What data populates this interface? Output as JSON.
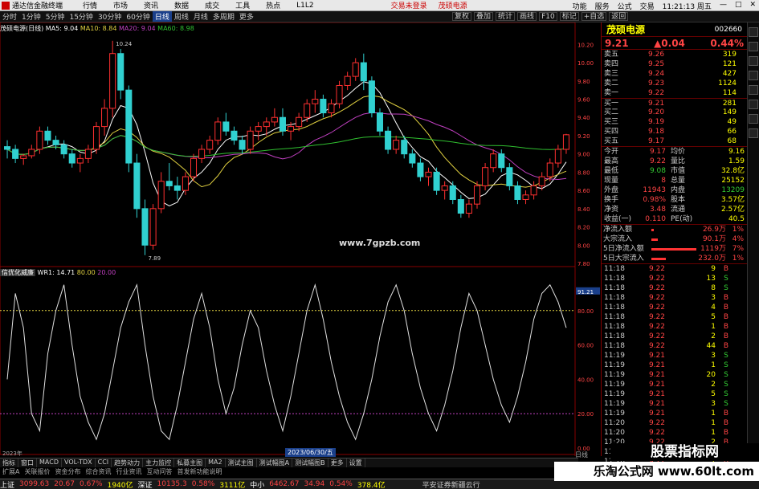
{
  "app": {
    "name": "通达信金融终端",
    "menus": [
      "行情",
      "市场",
      "资讯",
      "数据",
      "成交",
      "工具",
      "热点",
      "L1L2"
    ],
    "center": [
      "交易未登录",
      "茂硕电源"
    ],
    "right": [
      "功能",
      "服务",
      "公式",
      "交易"
    ],
    "time": "11:21:13 周五"
  },
  "toolbar": {
    "periods": [
      "分时",
      "1分钟",
      "5分钟",
      "15分钟",
      "30分钟",
      "60分钟",
      "日线",
      "周线",
      "月线",
      "多周期",
      "更多"
    ],
    "active_period": "日线",
    "tools": [
      "复权",
      "叠加",
      "统计",
      "画线",
      "F10",
      "标记",
      "+自选",
      "返回"
    ]
  },
  "chart_head": {
    "title": "茂硕电源(日线)",
    "ma5": "MA5: 9.04",
    "ma10": "MA10: 8.84",
    "ma20": "MA20: 9.04",
    "ma60": "MA60: 8.98"
  },
  "price_axis": [
    "10.20",
    "10.00",
    "9.80",
    "9.60",
    "9.40",
    "9.20",
    "9.00",
    "8.80",
    "8.60",
    "8.40",
    "8.20",
    "8.00",
    "7.80"
  ],
  "annotations": {
    "high": "10.24",
    "low": "7.89"
  },
  "watermark_center": "www.7gpzb.com",
  "indicator": {
    "name": "信优化威廉",
    "wr": "WR1: 14.71",
    "l1": "80.00",
    "l2": "20.00",
    "axis": [
      "91.21",
      "80.00",
      "60.00",
      "40.00",
      "20.00",
      "0.00"
    ]
  },
  "date_axis": {
    "start": "2023年",
    "highlight": "2023/06/30/五",
    "right": "日线"
  },
  "bottom_tabs": [
    "指标",
    "窗口",
    "MACD",
    "VOL-TDX",
    "CCI",
    "趋势动力",
    "主力监控",
    "私募主图",
    "MA2",
    "测试主图",
    "测试幅图A",
    "测试幅图B",
    "更多",
    "设置"
  ],
  "bottom_tabs2": [
    "扩展A",
    "关联报价",
    "资金分布",
    "综合资讯",
    "行业资讯",
    "互动问答",
    "首发新功能说明"
  ],
  "stock": {
    "name": "茂硕电源",
    "code": "002660",
    "price": "9.21",
    "change": "▲0.04",
    "pct": "0.44%"
  },
  "orderbook": [
    {
      "label": "卖五",
      "price": "9.26",
      "vol": "319"
    },
    {
      "label": "卖四",
      "price": "9.25",
      "vol": "121"
    },
    {
      "label": "卖三",
      "price": "9.24",
      "vol": "427"
    },
    {
      "label": "卖二",
      "price": "9.23",
      "vol": "1124"
    },
    {
      "label": "卖一",
      "price": "9.22",
      "vol": "114"
    },
    {
      "label": "买一",
      "price": "9.21",
      "vol": "281"
    },
    {
      "label": "买二",
      "price": "9.20",
      "vol": "149"
    },
    {
      "label": "买三",
      "price": "9.19",
      "vol": "49"
    },
    {
      "label": "买四",
      "price": "9.18",
      "vol": "66"
    },
    {
      "label": "买五",
      "price": "9.17",
      "vol": "68"
    }
  ],
  "stats": [
    [
      "今开",
      "9.17",
      "均价",
      "9.16"
    ],
    [
      "最高",
      "9.22",
      "量比",
      "1.59"
    ],
    [
      "最低",
      "9.08",
      "市值",
      "32.8亿"
    ],
    [
      "现量",
      "8",
      "总量",
      "25152"
    ],
    [
      "外盘",
      "11943",
      "内盘",
      "13209"
    ],
    [
      "换手",
      "0.98%",
      "股本",
      "3.57亿"
    ],
    [
      "净资",
      "3.48",
      "流通",
      "2.57亿"
    ],
    [
      "收益(一)",
      "0.110",
      "PE(动)",
      "40.5"
    ]
  ],
  "flows": [
    {
      "label": "净流入额",
      "val": "26.9万",
      "pct": "1%",
      "bar": 0.04
    },
    {
      "label": "大宗流入",
      "val": "90.1万",
      "pct": "4%",
      "bar": 0.12
    },
    {
      "label": "5日净流入额",
      "val": "1119万",
      "pct": "7%",
      "bar": 0.8
    },
    {
      "label": "5日大宗流入",
      "val": "232.0万",
      "pct": "1%",
      "bar": 0.25
    }
  ],
  "ticks": [
    [
      "11:18",
      "9.22",
      "9",
      "B"
    ],
    [
      "11:18",
      "9.22",
      "13",
      "S"
    ],
    [
      "11:18",
      "9.22",
      "8",
      "S"
    ],
    [
      "11:18",
      "9.22",
      "3",
      "B"
    ],
    [
      "11:18",
      "9.22",
      "4",
      "B"
    ],
    [
      "11:18",
      "9.22",
      "5",
      "B"
    ],
    [
      "11:18",
      "9.22",
      "1",
      "B"
    ],
    [
      "11:18",
      "9.22",
      "2",
      "B"
    ],
    [
      "11:18",
      "9.22",
      "44",
      "B"
    ],
    [
      "11:19",
      "9.21",
      "3",
      "S"
    ],
    [
      "11:19",
      "9.21",
      "1",
      "S"
    ],
    [
      "11:19",
      "9.21",
      "20",
      "S"
    ],
    [
      "11:19",
      "9.21",
      "2",
      "S"
    ],
    [
      "11:19",
      "9.21",
      "5",
      "S"
    ],
    [
      "11:19",
      "9.21",
      "3",
      "S"
    ],
    [
      "11:19",
      "9.21",
      "1",
      "B"
    ],
    [
      "11:20",
      "9.22",
      "1",
      "B"
    ],
    [
      "11:20",
      "9.22",
      "1",
      "B"
    ],
    [
      "11:20",
      "9.22",
      "2",
      "B"
    ],
    [
      "11:20",
      "9.22",
      "4",
      "B"
    ],
    [
      "11:20",
      "9.22",
      "1",
      "B"
    ]
  ],
  "status": {
    "items": [
      "上证",
      "3099.63",
      "20.67",
      "0.67%",
      "1940亿",
      "深证",
      "10135.3",
      "0.58%",
      "3111亿",
      "中小",
      "6462.67",
      "34.94",
      "0.54%",
      "378.4亿"
    ],
    "right": "平安证券新疆云行"
  },
  "wm_bottom1": "股票指标网",
  "wm_bottom2": "乐淘公式网 www.60lt.com",
  "colors": {
    "up": "#ff3030",
    "down": "#30d0d0",
    "ma5": "#ffffff",
    "ma10": "#e0d040",
    "ma20": "#c040c0",
    "ma60": "#30c030",
    "wr": "#e0e0e0"
  },
  "chart_data": {
    "type": "candlestick",
    "ylim": [
      7.8,
      10.3
    ],
    "candles": [
      [
        9.08,
        9.15,
        8.95,
        9.05
      ],
      [
        9.05,
        9.1,
        8.9,
        8.95
      ],
      [
        8.95,
        9.0,
        8.88,
        8.98
      ],
      [
        8.98,
        9.1,
        8.95,
        9.05
      ],
      [
        9.05,
        9.3,
        9.0,
        9.25
      ],
      [
        9.25,
        9.3,
        9.1,
        9.15
      ],
      [
        9.15,
        9.2,
        9.05,
        9.1
      ],
      [
        9.1,
        9.15,
        8.95,
        9.0
      ],
      [
        9.0,
        9.05,
        8.85,
        8.9
      ],
      [
        8.9,
        9.0,
        8.8,
        8.95
      ],
      [
        8.95,
        9.1,
        8.9,
        9.05
      ],
      [
        9.05,
        9.35,
        9.0,
        9.3
      ],
      [
        9.3,
        9.6,
        9.2,
        9.5
      ],
      [
        9.5,
        10.24,
        9.4,
        10.1
      ],
      [
        10.1,
        10.15,
        9.6,
        9.7
      ],
      [
        9.7,
        9.75,
        8.8,
        8.9
      ],
      [
        8.9,
        9.0,
        8.3,
        8.4
      ],
      [
        8.4,
        8.5,
        7.89,
        8.0
      ],
      [
        8.0,
        8.45,
        7.95,
        8.4
      ],
      [
        8.4,
        8.8,
        8.35,
        8.7
      ],
      [
        8.7,
        8.9,
        8.6,
        8.65
      ],
      [
        8.65,
        8.75,
        8.5,
        8.6
      ],
      [
        8.6,
        8.8,
        8.55,
        8.75
      ],
      [
        8.75,
        9.0,
        8.7,
        8.95
      ],
      [
        8.95,
        9.1,
        8.9,
        9.05
      ],
      [
        9.05,
        9.2,
        9.0,
        9.15
      ],
      [
        9.15,
        9.4,
        9.1,
        9.35
      ],
      [
        9.35,
        9.45,
        9.2,
        9.25
      ],
      [
        9.25,
        9.3,
        9.1,
        9.15
      ],
      [
        9.15,
        9.2,
        9.0,
        9.05
      ],
      [
        9.05,
        9.3,
        9.0,
        9.25
      ],
      [
        9.25,
        9.35,
        9.15,
        9.3
      ],
      [
        9.3,
        9.4,
        9.2,
        9.35
      ],
      [
        9.35,
        9.5,
        9.3,
        9.4
      ],
      [
        9.4,
        9.5,
        9.2,
        9.25
      ],
      [
        9.25,
        9.35,
        9.15,
        9.3
      ],
      [
        9.3,
        9.45,
        9.25,
        9.4
      ],
      [
        9.4,
        9.6,
        9.35,
        9.55
      ],
      [
        9.55,
        9.7,
        9.45,
        9.6
      ],
      [
        9.6,
        9.65,
        9.4,
        9.45
      ],
      [
        9.45,
        9.6,
        9.4,
        9.55
      ],
      [
        9.55,
        9.8,
        9.5,
        9.75
      ],
      [
        9.75,
        9.9,
        9.7,
        9.85
      ],
      [
        9.85,
        10.05,
        9.8,
        10.0
      ],
      [
        10.0,
        10.1,
        9.7,
        9.8
      ],
      [
        9.8,
        9.85,
        9.4,
        9.45
      ],
      [
        9.45,
        9.5,
        9.2,
        9.25
      ],
      [
        9.25,
        9.3,
        9.0,
        9.05
      ],
      [
        9.05,
        9.2,
        9.0,
        9.15
      ],
      [
        9.15,
        9.2,
        8.95,
        9.0
      ],
      [
        9.0,
        9.05,
        8.85,
        8.9
      ],
      [
        8.9,
        8.95,
        8.7,
        8.75
      ],
      [
        8.75,
        8.85,
        8.65,
        8.8
      ],
      [
        8.8,
        8.85,
        8.55,
        8.6
      ],
      [
        8.6,
        8.7,
        8.5,
        8.65
      ],
      [
        8.65,
        8.7,
        8.45,
        8.5
      ],
      [
        8.5,
        8.55,
        8.3,
        8.35
      ],
      [
        8.35,
        8.5,
        8.3,
        8.45
      ],
      [
        8.45,
        8.7,
        8.4,
        8.65
      ],
      [
        8.65,
        8.9,
        8.6,
        8.85
      ],
      [
        8.85,
        9.05,
        8.8,
        9.0
      ],
      [
        9.0,
        9.05,
        8.8,
        8.85
      ],
      [
        8.85,
        8.9,
        8.6,
        8.65
      ],
      [
        8.65,
        8.7,
        8.45,
        8.5
      ],
      [
        8.5,
        8.6,
        8.45,
        8.55
      ],
      [
        8.55,
        8.7,
        8.5,
        8.65
      ],
      [
        8.65,
        8.8,
        8.6,
        8.75
      ],
      [
        8.75,
        8.95,
        8.7,
        8.9
      ],
      [
        8.9,
        9.1,
        8.85,
        9.05
      ],
      [
        9.05,
        9.22,
        9.0,
        9.21
      ]
    ],
    "wr": [
      40,
      90,
      70,
      20,
      10,
      55,
      80,
      95,
      60,
      30,
      15,
      5,
      20,
      45,
      70,
      85,
      95,
      60,
      30,
      10,
      5,
      25,
      50,
      75,
      90,
      70,
      40,
      20,
      35,
      60,
      80,
      70,
      45,
      25,
      10,
      30,
      55,
      80,
      95,
      75,
      50,
      30,
      15,
      5,
      20,
      40,
      65,
      85,
      95,
      80,
      55,
      35,
      20,
      10,
      25,
      45,
      70,
      90,
      80,
      60,
      40,
      25,
      15,
      30,
      50,
      75,
      90,
      95,
      85,
      70
    ]
  }
}
